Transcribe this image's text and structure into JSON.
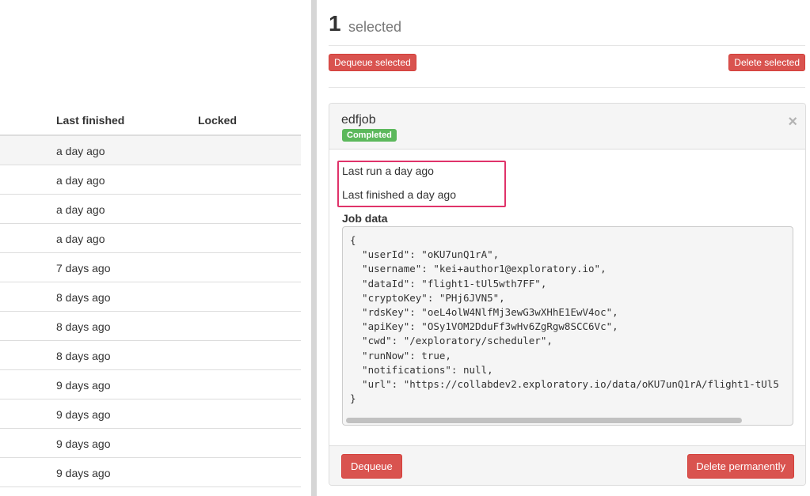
{
  "job_list": {
    "columns": {
      "last_finished": "Last finished",
      "locked": "Locked"
    },
    "rows": [
      {
        "last_finished": "a day ago",
        "locked": ""
      },
      {
        "last_finished": "a day ago",
        "locked": ""
      },
      {
        "last_finished": "a day ago",
        "locked": ""
      },
      {
        "last_finished": "a day ago",
        "locked": ""
      },
      {
        "last_finished": "7 days ago",
        "locked": ""
      },
      {
        "last_finished": "8 days ago",
        "locked": ""
      },
      {
        "last_finished": "8 days ago",
        "locked": ""
      },
      {
        "last_finished": "8 days ago",
        "locked": ""
      },
      {
        "last_finished": "9 days ago",
        "locked": ""
      },
      {
        "last_finished": "9 days ago",
        "locked": ""
      },
      {
        "last_finished": "9 days ago",
        "locked": ""
      },
      {
        "last_finished": "9 days ago",
        "locked": ""
      }
    ]
  },
  "selection": {
    "count": "1",
    "label": "selected",
    "dequeue_selected": "Dequeue selected",
    "delete_selected": "Delete selected"
  },
  "job_detail": {
    "name": "edfjob",
    "status": "Completed",
    "close_glyph": "×",
    "last_run": "Last run a day ago",
    "last_finished": "Last finished a day ago",
    "job_data_label": "Job data",
    "job_data_json": "{\n  \"userId\": \"oKU7unQ1rA\",\n  \"username\": \"kei+author1@exploratory.io\",\n  \"dataId\": \"flight1-tUl5wth7FF\",\n  \"cryptoKey\": \"PHj6JVN5\",\n  \"rdsKey\": \"oeL4olW4NlfMj3ewG3wXHhE1EwV4oc\",\n  \"apiKey\": \"OSy1VOM2DduFf3wHv6ZgRgw8SCC6Vc\",\n  \"cwd\": \"/exploratory/scheduler\",\n  \"runNow\": true,\n  \"notifications\": null,\n  \"url\": \"https://collabdev2.exploratory.io/data/oKU7unQ1rA/flight1-tUl5\n}",
    "dequeue": "Dequeue",
    "delete_permanently": "Delete permanently"
  },
  "colors": {
    "danger": "#d9534f",
    "success": "#5cb85c",
    "highlight": "#e0336a"
  }
}
